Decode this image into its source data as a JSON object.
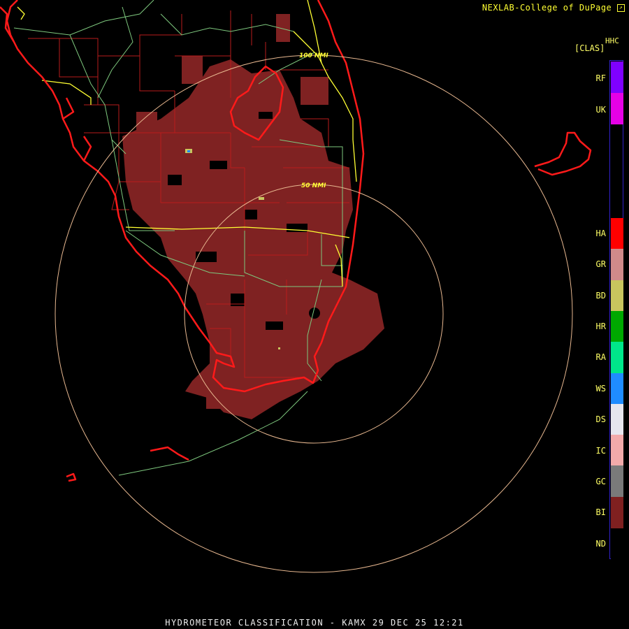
{
  "header": {
    "credit": "NEXLAB-College of DuPage",
    "credit_icon": "arrow-box-icon",
    "product": "HHC",
    "units": "[CLAS]"
  },
  "rings": [
    {
      "label": "100 NMI"
    },
    {
      "label": "50 NMI"
    }
  ],
  "legend": {
    "classes": [
      {
        "code": "RF",
        "color": "#7f00ff"
      },
      {
        "code": "UK",
        "color": "#e600e6"
      },
      {
        "code": "HA",
        "color": "#ff0000"
      },
      {
        "code": "GR",
        "color": "#d08a8a"
      },
      {
        "code": "BD",
        "color": "#c8c55e"
      },
      {
        "code": "HR",
        "color": "#00a800"
      },
      {
        "code": "RA",
        "color": "#00e68a"
      },
      {
        "code": "WS",
        "color": "#1f8cff"
      },
      {
        "code": "DS",
        "color": "#e6e6ee"
      },
      {
        "code": "IC",
        "color": "#f2aaaa"
      },
      {
        "code": "GC",
        "color": "#7a7a7a"
      },
      {
        "code": "BI",
        "color": "#7f2020"
      },
      {
        "code": "ND",
        "color": "#000000"
      }
    ]
  },
  "colors": {
    "background": "#000000",
    "coastline": "#ff1a1a",
    "county_lines": "#b81c1c",
    "state_lines": "#7ec87e",
    "highways": "#ffff33",
    "range_rings": "#e8b890",
    "echo_fill": "#7f2222"
  },
  "footer": "HYDROMETEOR CLASSIFICATION - KAMX 29 DEC 25 12:21"
}
